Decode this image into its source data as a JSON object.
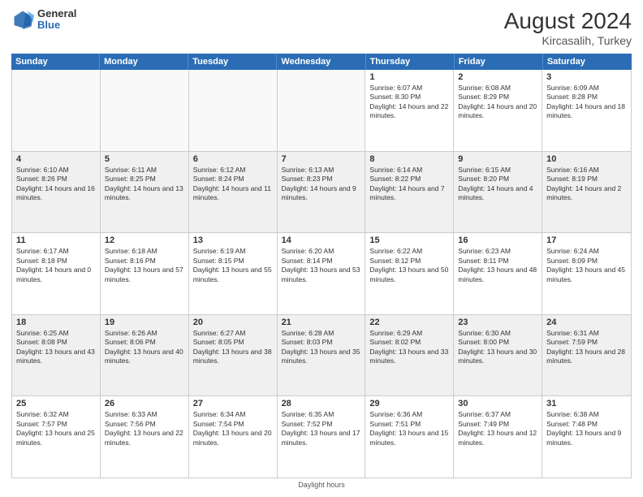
{
  "header": {
    "logo_general": "General",
    "logo_blue": "Blue",
    "month_year": "August 2024",
    "location": "Kircasalih, Turkey"
  },
  "days_of_week": [
    "Sunday",
    "Monday",
    "Tuesday",
    "Wednesday",
    "Thursday",
    "Friday",
    "Saturday"
  ],
  "weeks": [
    {
      "cells": [
        {
          "empty": true
        },
        {
          "empty": true
        },
        {
          "empty": true
        },
        {
          "empty": true
        },
        {
          "day": "1",
          "sunrise": "6:07 AM",
          "sunset": "8:30 PM",
          "daylight": "14 hours and 22 minutes."
        },
        {
          "day": "2",
          "sunrise": "6:08 AM",
          "sunset": "8:29 PM",
          "daylight": "14 hours and 20 minutes."
        },
        {
          "day": "3",
          "sunrise": "6:09 AM",
          "sunset": "8:28 PM",
          "daylight": "14 hours and 18 minutes."
        }
      ]
    },
    {
      "cells": [
        {
          "day": "4",
          "sunrise": "6:10 AM",
          "sunset": "8:26 PM",
          "daylight": "14 hours and 16 minutes."
        },
        {
          "day": "5",
          "sunrise": "6:11 AM",
          "sunset": "8:25 PM",
          "daylight": "14 hours and 13 minutes."
        },
        {
          "day": "6",
          "sunrise": "6:12 AM",
          "sunset": "8:24 PM",
          "daylight": "14 hours and 11 minutes."
        },
        {
          "day": "7",
          "sunrise": "6:13 AM",
          "sunset": "8:23 PM",
          "daylight": "14 hours and 9 minutes."
        },
        {
          "day": "8",
          "sunrise": "6:14 AM",
          "sunset": "8:22 PM",
          "daylight": "14 hours and 7 minutes."
        },
        {
          "day": "9",
          "sunrise": "6:15 AM",
          "sunset": "8:20 PM",
          "daylight": "14 hours and 4 minutes."
        },
        {
          "day": "10",
          "sunrise": "6:16 AM",
          "sunset": "8:19 PM",
          "daylight": "14 hours and 2 minutes."
        }
      ]
    },
    {
      "cells": [
        {
          "day": "11",
          "sunrise": "6:17 AM",
          "sunset": "8:18 PM",
          "daylight": "14 hours and 0 minutes."
        },
        {
          "day": "12",
          "sunrise": "6:18 AM",
          "sunset": "8:16 PM",
          "daylight": "13 hours and 57 minutes."
        },
        {
          "day": "13",
          "sunrise": "6:19 AM",
          "sunset": "8:15 PM",
          "daylight": "13 hours and 55 minutes."
        },
        {
          "day": "14",
          "sunrise": "6:20 AM",
          "sunset": "8:14 PM",
          "daylight": "13 hours and 53 minutes."
        },
        {
          "day": "15",
          "sunrise": "6:22 AM",
          "sunset": "8:12 PM",
          "daylight": "13 hours and 50 minutes."
        },
        {
          "day": "16",
          "sunrise": "6:23 AM",
          "sunset": "8:11 PM",
          "daylight": "13 hours and 48 minutes."
        },
        {
          "day": "17",
          "sunrise": "6:24 AM",
          "sunset": "8:09 PM",
          "daylight": "13 hours and 45 minutes."
        }
      ]
    },
    {
      "cells": [
        {
          "day": "18",
          "sunrise": "6:25 AM",
          "sunset": "8:08 PM",
          "daylight": "13 hours and 43 minutes."
        },
        {
          "day": "19",
          "sunrise": "6:26 AM",
          "sunset": "8:06 PM",
          "daylight": "13 hours and 40 minutes."
        },
        {
          "day": "20",
          "sunrise": "6:27 AM",
          "sunset": "8:05 PM",
          "daylight": "13 hours and 38 minutes."
        },
        {
          "day": "21",
          "sunrise": "6:28 AM",
          "sunset": "8:03 PM",
          "daylight": "13 hours and 35 minutes."
        },
        {
          "day": "22",
          "sunrise": "6:29 AM",
          "sunset": "8:02 PM",
          "daylight": "13 hours and 33 minutes."
        },
        {
          "day": "23",
          "sunrise": "6:30 AM",
          "sunset": "8:00 PM",
          "daylight": "13 hours and 30 minutes."
        },
        {
          "day": "24",
          "sunrise": "6:31 AM",
          "sunset": "7:59 PM",
          "daylight": "13 hours and 28 minutes."
        }
      ]
    },
    {
      "cells": [
        {
          "day": "25",
          "sunrise": "6:32 AM",
          "sunset": "7:57 PM",
          "daylight": "13 hours and 25 minutes."
        },
        {
          "day": "26",
          "sunrise": "6:33 AM",
          "sunset": "7:56 PM",
          "daylight": "13 hours and 22 minutes."
        },
        {
          "day": "27",
          "sunrise": "6:34 AM",
          "sunset": "7:54 PM",
          "daylight": "13 hours and 20 minutes."
        },
        {
          "day": "28",
          "sunrise": "6:35 AM",
          "sunset": "7:52 PM",
          "daylight": "13 hours and 17 minutes."
        },
        {
          "day": "29",
          "sunrise": "6:36 AM",
          "sunset": "7:51 PM",
          "daylight": "13 hours and 15 minutes."
        },
        {
          "day": "30",
          "sunrise": "6:37 AM",
          "sunset": "7:49 PM",
          "daylight": "13 hours and 12 minutes."
        },
        {
          "day": "31",
          "sunrise": "6:38 AM",
          "sunset": "7:48 PM",
          "daylight": "13 hours and 9 minutes."
        }
      ]
    }
  ],
  "footer": "Daylight hours"
}
